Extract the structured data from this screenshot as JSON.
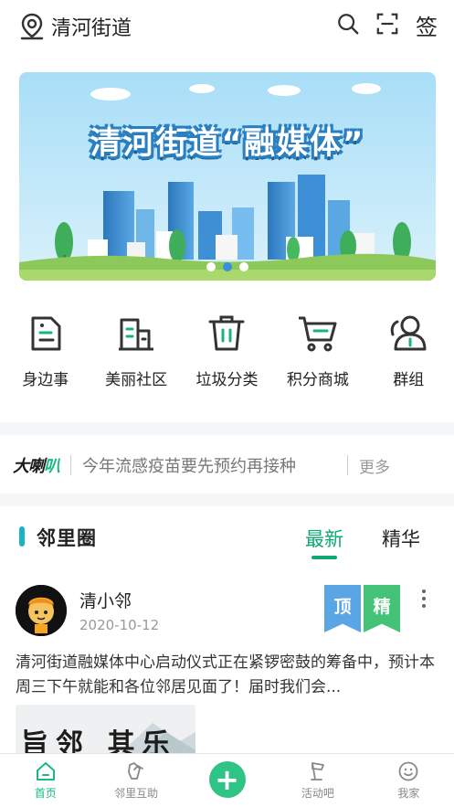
{
  "header": {
    "location": "清河街道",
    "search_icon": "search-icon",
    "scan_icon": "scan-icon",
    "sign_label": "签"
  },
  "banner": {
    "title": "清河街道“融媒体”",
    "slides": 3,
    "active_slide": 2
  },
  "menu": {
    "items": [
      {
        "label": "身边事",
        "icon": "document-icon"
      },
      {
        "label": "美丽社区",
        "icon": "buildings-icon"
      },
      {
        "label": "垃圾分类",
        "icon": "trash-icon"
      },
      {
        "label": "积分商城",
        "icon": "cart-icon"
      },
      {
        "label": "群组",
        "icon": "group-icon"
      }
    ]
  },
  "notice": {
    "tag_prefix": "大喇",
    "tag_suffix": "叭",
    "text": "今年流感疫苗要先预约再接种",
    "more": "更多"
  },
  "neighborhood": {
    "title": "邻里圈",
    "tabs": [
      {
        "label": "最新",
        "active": true
      },
      {
        "label": "精华",
        "active": false
      }
    ]
  },
  "post": {
    "author": "清小邻",
    "date": "2020-10-12",
    "badge_top": "顶",
    "badge_best": "精",
    "text": "清河街道融媒体中心启动仪式正在紧锣密鼓的筹备中，预计本周三下午就能和各位邻居见面了！届时我们会...",
    "image_text": "旨邻 其乐"
  },
  "bottom_nav": {
    "items": [
      {
        "label": "首页",
        "icon": "home-icon",
        "active": true
      },
      {
        "label": "邻里互助",
        "icon": "handshake-icon",
        "active": false
      },
      {
        "label": "",
        "icon": "plus-icon",
        "active": false
      },
      {
        "label": "活动吧",
        "icon": "flag-icon",
        "active": false
      },
      {
        "label": "我家",
        "icon": "smile-icon",
        "active": false
      }
    ]
  },
  "colors": {
    "accent": "#10a873",
    "banner_sky": "#aee0f7",
    "badge_top": "#5aa6e4",
    "badge_best": "#44c278"
  }
}
